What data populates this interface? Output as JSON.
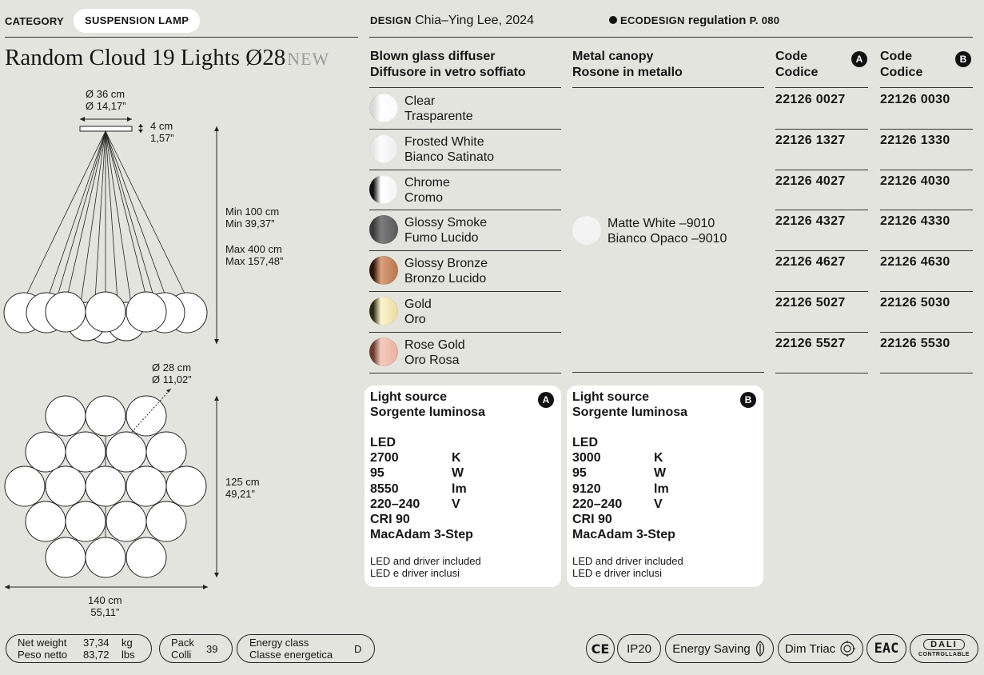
{
  "header": {
    "category_label": "CATEGORY",
    "category_value": "SUSPENSION LAMP",
    "design_label": "DESIGN",
    "designer": "Chia–Ying Lee, 2024",
    "eco_label": "ECODESIGN",
    "eco_text": "regulation",
    "eco_page": "P. 080"
  },
  "product": {
    "name": "Random Cloud 19 Lights Ø28",
    "badge": "NEW"
  },
  "drawing": {
    "canopy_d_cm": "Ø 36 cm",
    "canopy_d_in": "Ø 14,17”",
    "canopy_h_cm": "4 cm",
    "canopy_h_in": "1,57”",
    "min_cm": "Min 100 cm",
    "min_in": "Min 39,37”",
    "max_cm": "Max 400 cm",
    "max_in": "Max 157,48”",
    "sphere_cm": "Ø 28 cm",
    "sphere_in": "Ø 11,02”",
    "height_cm": "125 cm",
    "height_in": "49,21”",
    "width_cm": "140 cm",
    "width_in": "55,11”"
  },
  "table": {
    "col_diffuser": [
      "Blown glass diffuser",
      "Diffusore in vetro soffiato"
    ],
    "col_canopy": [
      "Metal canopy",
      "Rosone in metallo"
    ],
    "col_code_a": [
      "Code",
      "Codice"
    ],
    "col_code_b": [
      "Code",
      "Codice"
    ],
    "badge_a": "A",
    "badge_b": "B",
    "canopy_name": [
      "Matte White –9010",
      "Bianco Opaco –9010"
    ],
    "canopy_color": "#f3f3f3",
    "rows": [
      {
        "en": "Clear",
        "it": "Trasparente",
        "code_a": "22126 0027",
        "code_b": "22126 0030",
        "left": "#d8d8d8",
        "mid": "#ffffff",
        "right": "#fafafa"
      },
      {
        "en": "Frosted White",
        "it": "Bianco Satinato",
        "code_a": "22126 1327",
        "code_b": "22126 1330",
        "left": "#e6e6e6",
        "mid": "#fbfbfb",
        "right": "#ededed"
      },
      {
        "en": "Chrome",
        "it": "Cromo",
        "code_a": "22126 4027",
        "code_b": "22126 4030",
        "left": "#111111",
        "mid": "#ffffff",
        "right": "#f2f2f2"
      },
      {
        "en": "Glossy Smoke",
        "it": "Fumo Lucido",
        "code_a": "22126 4327",
        "code_b": "22126 4330",
        "left": "#3a3a3a",
        "mid": "#7d7d7d",
        "right": "#5a5a5a"
      },
      {
        "en": "Glossy Bronze",
        "it": "Bronzo Lucido",
        "code_a": "22126 4627",
        "code_b": "22126 4630",
        "left": "#2a1408",
        "mid": "#d9a07c",
        "right": "#b8754e"
      },
      {
        "en": "Gold",
        "it": "Oro",
        "code_a": "22126 5027",
        "code_b": "22126 5030",
        "left": "#2b2a10",
        "mid": "#fbf3cf",
        "right": "#eadca0"
      },
      {
        "en": "Rose Gold",
        "it": "Oro Rosa",
        "code_a": "22126 5527",
        "code_b": "22126 5530",
        "left": "#6a3a30",
        "mid": "#f4cbbd",
        "right": "#e8b1a2"
      }
    ]
  },
  "cards": [
    {
      "title_en": "Light source",
      "title_it": "Sorgente luminosa",
      "badge": "A",
      "type": "LED",
      "specs": [
        {
          "v": "2700",
          "u": "K"
        },
        {
          "v": "95",
          "u": "W"
        },
        {
          "v": "8550",
          "u": "lm"
        },
        {
          "v": "220–240",
          "u": "V"
        }
      ],
      "cri": "CRI 90",
      "macadam": "MacAdam 3-Step",
      "note_en": "LED and driver included",
      "note_it": "LED e driver inclusi"
    },
    {
      "title_en": "Light source",
      "title_it": "Sorgente luminosa",
      "badge": "B",
      "type": "LED",
      "specs": [
        {
          "v": "3000",
          "u": "K"
        },
        {
          "v": "95",
          "u": "W"
        },
        {
          "v": "9120",
          "u": "lm"
        },
        {
          "v": "220–240",
          "u": "V"
        }
      ],
      "cri": "CRI 90",
      "macadam": "MacAdam 3-Step",
      "note_en": "LED and driver included",
      "note_it": "LED e driver inclusi"
    }
  ],
  "footer": {
    "weight_label_en": "Net weight",
    "weight_label_it": "Peso netto",
    "weight_kg": "37,34",
    "weight_kg_unit": "kg",
    "weight_lbs": "83,72",
    "weight_lbs_unit": "lbs",
    "pack_en": "Pack",
    "pack_it": "Colli",
    "pack_value": "39",
    "energy_en": "Energy class",
    "energy_it": "Classe energetica",
    "energy_value": "D",
    "cert_ce": "CE",
    "cert_ip": "IP20",
    "cert_energy_saving": "Energy Saving",
    "cert_dim": "Dim Triac",
    "cert_eac": "EAC",
    "cert_dali": "DALI",
    "cert_dali_sub": "CONTROLLABLE"
  }
}
